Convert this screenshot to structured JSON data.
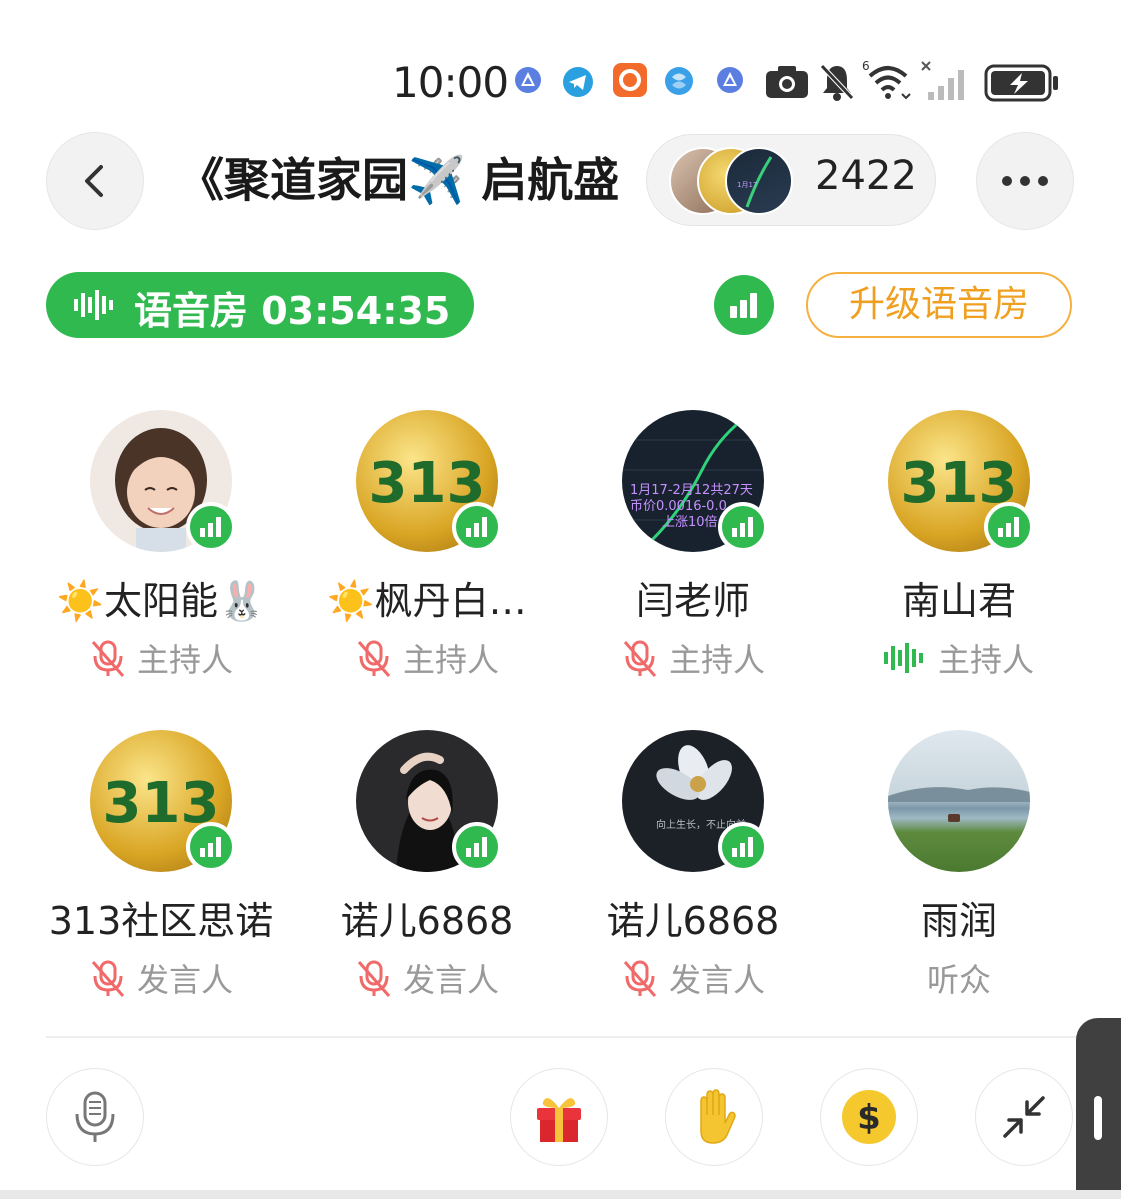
{
  "status_bar": {
    "time": "10:00",
    "icons": [
      "app-icon",
      "telegram-icon",
      "app-icon",
      "app-icon",
      "app-icon",
      "camera-icon",
      "bell-muted-icon",
      "wifi-icon",
      "signal-icon",
      "battery-charging-icon"
    ]
  },
  "header": {
    "title": "《聚道家园✈️ 启航盛",
    "member_count": "2422"
  },
  "room": {
    "label": "语音房 03:54:35",
    "upgrade_label": "升级语音房"
  },
  "members": [
    {
      "name": "☀️太阳能🐰",
      "role": "主持人",
      "mic": "muted",
      "avatar": "girl"
    },
    {
      "name": "☀️枫丹白…",
      "role": "主持人",
      "mic": "muted",
      "avatar": "gold313"
    },
    {
      "name": "闫老师",
      "role": "主持人",
      "mic": "muted",
      "avatar": "chart"
    },
    {
      "name": "南山君",
      "role": "主持人",
      "mic": "speaking",
      "avatar": "gold313"
    },
    {
      "name": "313社区思诺",
      "role": "发言人",
      "mic": "muted",
      "avatar": "gold313"
    },
    {
      "name": "诺儿6868",
      "role": "发言人",
      "mic": "muted",
      "avatar": "woman"
    },
    {
      "name": "诺儿6868",
      "role": "发言人",
      "mic": "muted",
      "avatar": "flower"
    },
    {
      "name": "雨润",
      "role": "听众",
      "mic": "none",
      "avatar": "landscape"
    }
  ],
  "colors": {
    "accent_green": "#2fb94f",
    "upgrade_orange": "#f0a020",
    "muted_red": "#f06a6a"
  }
}
